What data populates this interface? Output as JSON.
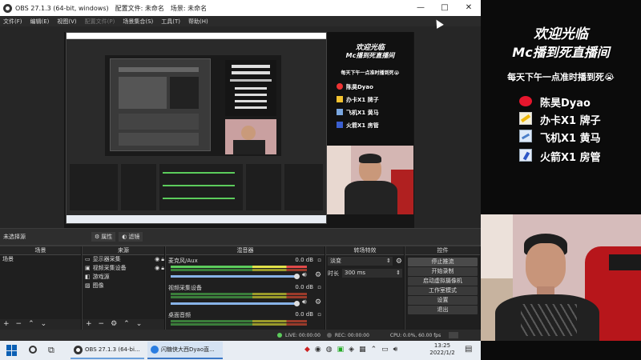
{
  "window": {
    "title": "OBS 27.1.3 (64-bit, windows)",
    "profile": "配置文件: 未命名",
    "scene_collection": "场景: 未命名",
    "controls": [
      "—",
      "□",
      "✕"
    ]
  },
  "menu": {
    "items": [
      "文件(F)",
      "编辑(E)",
      "视图(V)",
      "配置文件(P)",
      "场景集合(S)",
      "工具(T)",
      "帮助(H)"
    ]
  },
  "overlay": {
    "welcome_line1": "欢迎光临",
    "welcome_line2": "Mc播到死直播间",
    "tagline": "每天下午一点准时播到死😭",
    "items": [
      {
        "label": "陈昊Dyao",
        "icon": "weibo-icon"
      },
      {
        "label": "办卡X1 牌子",
        "icon": "card-icon"
      },
      {
        "label": "飞机X1 黄马",
        "icon": "plane-icon"
      },
      {
        "label": "火箭X1 房管",
        "icon": "rocket-icon"
      }
    ]
  },
  "source_toolbar": {
    "no_source": "未选择源",
    "properties": "属性",
    "filters": "滤镜"
  },
  "scenes": {
    "header": "场景",
    "items": [
      "场景"
    ]
  },
  "sources": {
    "header": "来源",
    "items": [
      "显示器采集",
      "视频采集设备",
      "游戏源",
      "图像"
    ]
  },
  "mixer": {
    "header": "混音器",
    "channels": [
      {
        "name": "麦克风/Aux",
        "db": "0.0 dB"
      },
      {
        "name": "视频采集设备",
        "db": "0.0 dB"
      },
      {
        "name": "桌面音频",
        "db": "0.0 dB"
      }
    ]
  },
  "transitions": {
    "header": "转场特效",
    "selected": "淡变",
    "duration_label": "时长",
    "duration_value": "300 ms"
  },
  "controls": {
    "header": "控件",
    "buttons": [
      "停止推流",
      "开始录制",
      "启动虚拟摄像机",
      "工作室模式",
      "设置",
      "退出"
    ]
  },
  "status": {
    "live": "LIVE: 00:00:00",
    "rec": "REC: 00:00:00",
    "cpu": "CPU: 0.0%, 60.00 fps"
  },
  "taskbar": {
    "apps": [
      "OBS 27.1.3 (64-bi...",
      "闪糖侠大西Dyao直..."
    ],
    "time": "13:25",
    "date": "2022/1/2"
  },
  "colors": {
    "obs_dark": "#262626",
    "meter_green": "#5ccc5c",
    "meter_yellow": "#e3e34a",
    "meter_red": "#e34a4a",
    "accent_blue": "#88b3e8"
  }
}
